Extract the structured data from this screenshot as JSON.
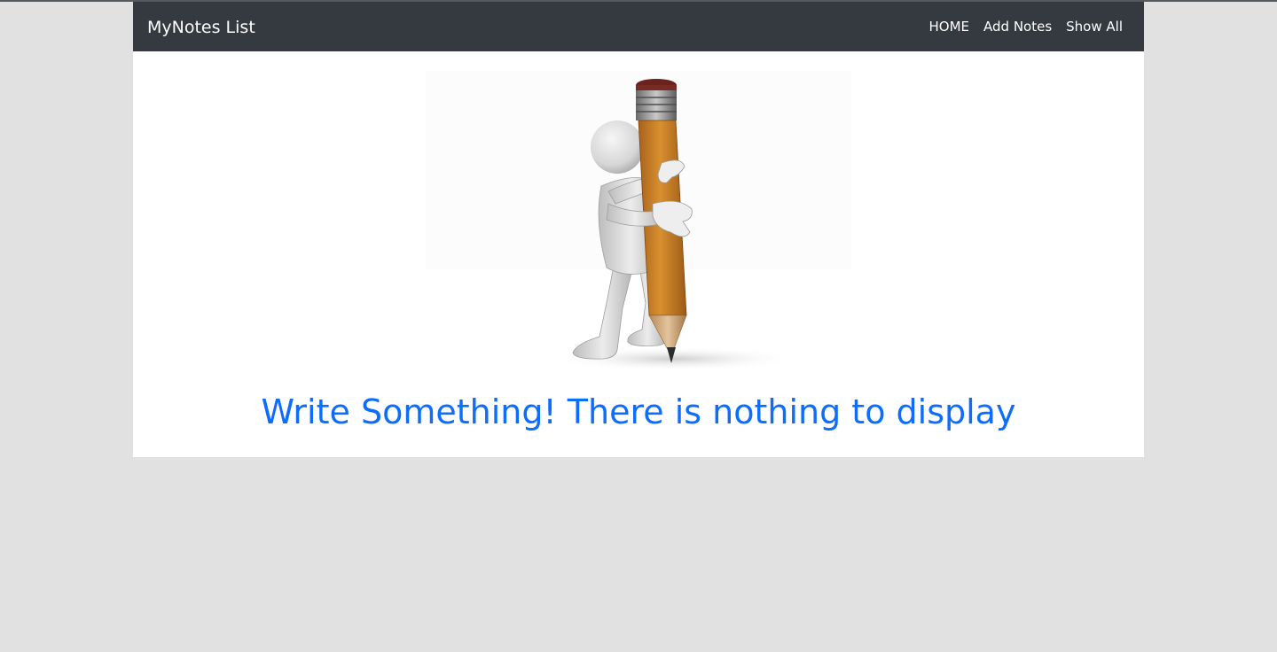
{
  "navbar": {
    "brand": "MyNotes List",
    "links": [
      {
        "label": "HOME"
      },
      {
        "label": "Add Notes"
      },
      {
        "label": "Show All"
      }
    ],
    "background_color": "#343a40",
    "text_color": "#ffffff"
  },
  "main": {
    "illustration": {
      "description_icon": "stick-figure-hugging-pencil-illustration"
    },
    "empty_message": "Write Something! There is nothing to display",
    "message_color": "#0d6efd"
  },
  "page": {
    "background_color": "#e1e1e1"
  }
}
